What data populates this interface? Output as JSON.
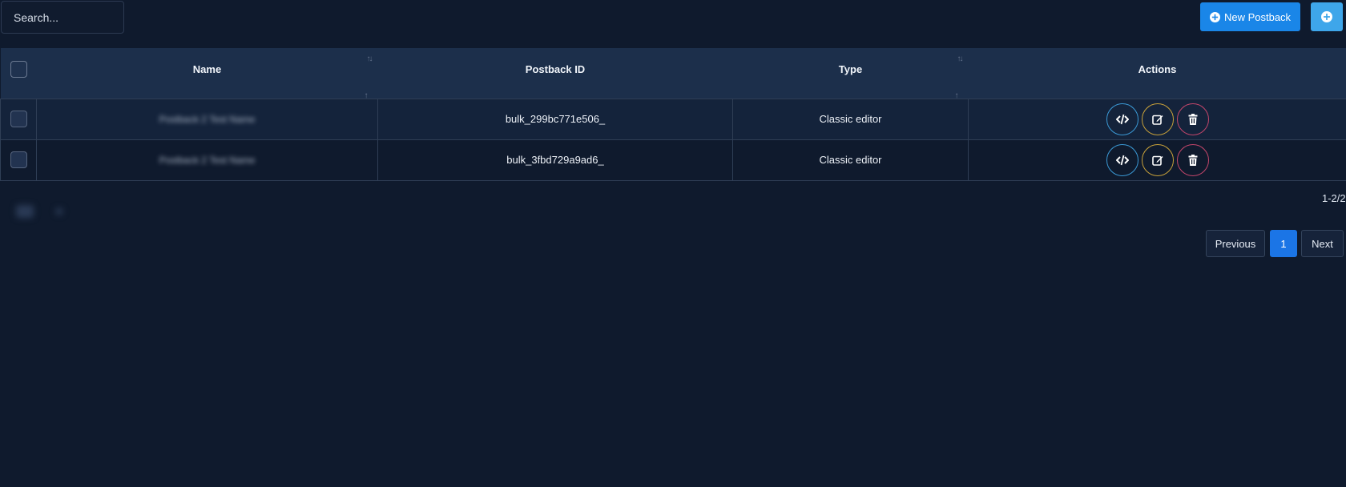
{
  "toolbar": {
    "search_placeholder": "Search...",
    "new_postback_label": "New Postback"
  },
  "table": {
    "columns": [
      "Name",
      "Postback ID",
      "Type",
      "Actions"
    ],
    "rows": [
      {
        "name": "Postback 2 Test Name",
        "postback_id": "bulk_299bc771e506_",
        "type": "Classic editor"
      },
      {
        "name": "Postback 2 Test Name",
        "postback_id": "bulk_3fbd729a9ad6_",
        "type": "Classic editor"
      }
    ]
  },
  "pagination": {
    "range": "1-2/2",
    "previous_label": "Previous",
    "current_page": "1",
    "next_label": "Next"
  },
  "colors": {
    "background": "#0f1a2d",
    "header_bg": "#1c2f4b",
    "primary": "#1a86e8",
    "code_action": "#3b9ad6",
    "edit_action": "#c9a23a",
    "delete_action": "#c4466b"
  },
  "icons": {
    "new_button": "plus-circle-icon",
    "add_button": "plus-circle-icon",
    "actions": [
      "code-icon",
      "edit-icon",
      "trash-icon"
    ]
  }
}
